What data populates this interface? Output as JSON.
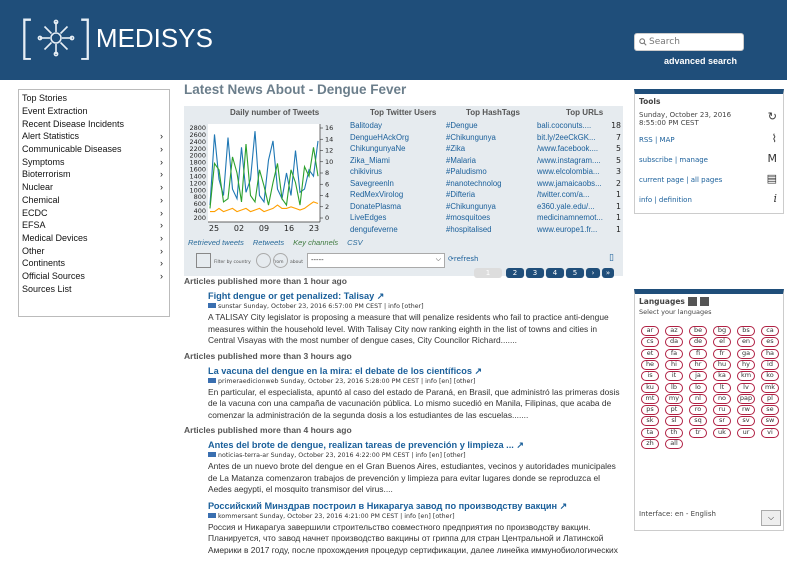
{
  "header": {
    "brand": "MEDISYS",
    "search_placeholder": "Search",
    "advanced_search": "advanced search"
  },
  "nav": [
    {
      "label": "Top Stories",
      "arrow": ""
    },
    {
      "label": "Event Extraction",
      "arrow": ""
    },
    {
      "label": "Recent Disease Incidents",
      "arrow": ""
    },
    {
      "label": "Alert Statistics",
      "arrow": "›"
    },
    {
      "label": "Communicable Diseases",
      "arrow": "›"
    },
    {
      "label": "Symptoms",
      "arrow": "›"
    },
    {
      "label": "Bioterrorism",
      "arrow": "›"
    },
    {
      "label": "Nuclear",
      "arrow": "›"
    },
    {
      "label": "Chemical",
      "arrow": "›"
    },
    {
      "label": "ECDC",
      "arrow": "›"
    },
    {
      "label": "EFSA",
      "arrow": "›"
    },
    {
      "label": "Medical Devices",
      "arrow": "›"
    },
    {
      "label": "Other",
      "arrow": "›"
    },
    {
      "label": "Continents",
      "arrow": "›"
    },
    {
      "label": "Official Sources",
      "arrow": "›"
    },
    {
      "label": "Sources List",
      "arrow": ""
    }
  ],
  "page_title": "Latest News About - Dengue Fever",
  "chart_data": {
    "type": "line",
    "title": "Daily number of Tweets",
    "x_ticks": [
      "25",
      "02",
      "09",
      "16",
      "23"
    ],
    "y_left_ticks": [
      "2800",
      "2600",
      "2400",
      "2200",
      "2000",
      "1800",
      "1600",
      "1400",
      "1200",
      "1000",
      "800",
      "600",
      "400",
      "200"
    ],
    "y_right_ticks": [
      "16",
      "14",
      "12",
      "10",
      "8",
      "6",
      "4",
      "2",
      "0"
    ],
    "series": [
      {
        "color": "#1f77b4",
        "values": [
          400,
          2600,
          1200,
          700,
          2500,
          900,
          600,
          2200,
          800,
          1200,
          2700,
          700,
          500,
          1800,
          2400,
          900,
          600,
          1400,
          700,
          2100,
          800,
          900,
          1500,
          1300,
          2400
        ]
      },
      {
        "color": "#2ca02c",
        "values": [
          300,
          1700,
          1500,
          500,
          600,
          1900,
          1400,
          500,
          2300,
          700,
          500,
          1500,
          1000,
          400,
          1100,
          1700,
          600,
          400,
          1500,
          1100,
          400,
          1600,
          1300,
          2200,
          1300
        ]
      },
      {
        "color": "#ff9f00",
        "values": [
          200,
          200,
          300,
          200,
          250,
          300,
          200,
          250,
          300,
          200,
          250,
          300,
          200,
          250,
          300,
          400,
          300,
          300,
          350,
          300,
          250,
          300,
          400,
          500,
          450
        ]
      }
    ],
    "legend_tabs": [
      "Retrieved tweets",
      "Retweets",
      "Key channels",
      "CSV"
    ]
  },
  "twitter": {
    "users_title": "Top Twitter Users",
    "users": [
      "Balitoday",
      "DengueHAckOrg",
      "ChikungunyaNe",
      "Zika_Miami",
      "chikivirus",
      "Savegreenln",
      "RedMexVirolog",
      "DonatePlasma",
      "LiveEdges",
      "dengufeverne"
    ],
    "tags_title": "Top HashTags",
    "tags": [
      "#Dengue",
      "#Chikungunya",
      "#Zika",
      "#Malaria",
      "#Paludismo",
      "#nanotechnolog",
      "#Difteria",
      "#Chikungunya",
      "#mosquitoes",
      "#hospitalised"
    ],
    "urls_title": "Top URLs",
    "urls": [
      "bali.coconuts....",
      "bit.ly/2eeCkGK...",
      "/www.facebook....",
      "/www.instagram....",
      "www.elcolombia...",
      "www.jamaicaobs...",
      "/twitter.com/a...",
      "e360.yale.edu/...",
      "medicinamnemot...",
      "www.europe1.fr..."
    ],
    "url_counts": [
      "18",
      "7",
      "5",
      "5",
      "3",
      "2",
      "1",
      "1",
      "1",
      "1"
    ]
  },
  "filter": {
    "country_label": "Filter by country",
    "from_label": "from",
    "about_label": "about",
    "select_value": "-----",
    "refresh": "refresh"
  },
  "pager": [
    "1",
    "2",
    "3",
    "4",
    "5",
    "›",
    "»"
  ],
  "groups": [
    {
      "ago": "Articles published more than  1  hour  ago",
      "articles": [
        {
          "title": "Fight dengue or get penalized: Talisay",
          "meta": "sunstar Sunday, October 23, 2016 6:57:00 PM CEST | info [other]",
          "body": "A TALISAY City legislator is proposing a measure that will penalize residents who fail to practice anti-dengue measures within the household level. With Talisay City now ranking eighth in the list of towns and cities in Central Visayas with the most number of dengue cases, City Councilor Richard......."
        }
      ]
    },
    {
      "ago": "Articles published more than  3  hours  ago",
      "articles": [
        {
          "title": "La vacuna del dengue en la mira: el debate de los científicos",
          "meta": "primeraedicionweb Sunday, October 23, 2016 5:28:00 PM CEST | info  [en] [other]",
          "body": "En particular, el especialista, apuntó al caso del estado de Paraná, en Brasil, que administró las primeras dosis de la vacuna con una campaña de vacunación pública. Lo mismo sucedió en Manila, Filipinas, que acaba de comenzar la administración de la segunda dosis a los estudiantes de las escuelas......."
        }
      ]
    },
    {
      "ago": "Articles published more than  4  hours  ago",
      "articles": [
        {
          "title": "Antes del brote de dengue, realizan tareas de prevención y limpieza ...",
          "meta": "noticias-terra-ar Sunday, October 23, 2016 4:22:00 PM CEST | info  [en] [other]",
          "body": "Antes de un nuevo brote del dengue en el Gran Buenos Aires, estudiantes, vecinos y autoridades municipales de La Matanza comenzaron trabajos de prevención y limpieza para evitar lugares donde se reproduzca el Aedes aegypti, el mosquito transmisor del virus...."
        },
        {
          "title": "Российский Минздрав построил в Никарагуа завод по производству вакцин",
          "meta": "kommersant Sunday, October 23, 2016 4:21:00 PM CEST | info  [en] [other]",
          "body": "Россия и Никарагуа завершили строительство совместного предприятия по производству вакцин. Планируется, что завод начнет производство вакцины от гриппа для стран Центральной и Латинской Америки в 2017 году, после прохождения процедур сертификации, далее линейка иммунобиологических"
        }
      ]
    }
  ],
  "tools": {
    "title": "Tools",
    "date": "Sunday, October 23, 2016",
    "time": "8:55:00 PM CEST",
    "rss": "RSS | MAP",
    "subscribe": "subscribe | manage",
    "current": "current page | all pages",
    "info": "info | definition"
  },
  "languages": {
    "title": "Languages",
    "select_label": "Select your languages",
    "codes": [
      "ar",
      "az",
      "be",
      "bg",
      "bs",
      "ca",
      "cs",
      "da",
      "de",
      "el",
      "en",
      "es",
      "et",
      "fa",
      "fi",
      "fr",
      "ga",
      "ha",
      "he",
      "hi",
      "hr",
      "hu",
      "hy",
      "id",
      "is",
      "it",
      "ja",
      "ka",
      "km",
      "ko",
      "ku",
      "lb",
      "lo",
      "lt",
      "lv",
      "mk",
      "mt",
      "my",
      "nl",
      "no",
      "pap",
      "pl",
      "ps",
      "pt",
      "ro",
      "ru",
      "rw",
      "se",
      "sk",
      "sl",
      "sq",
      "sr",
      "sv",
      "sw",
      "ta",
      "th",
      "tr",
      "uk",
      "ur",
      "vi",
      "zh",
      "all"
    ],
    "interface": "Interface: en - English"
  }
}
